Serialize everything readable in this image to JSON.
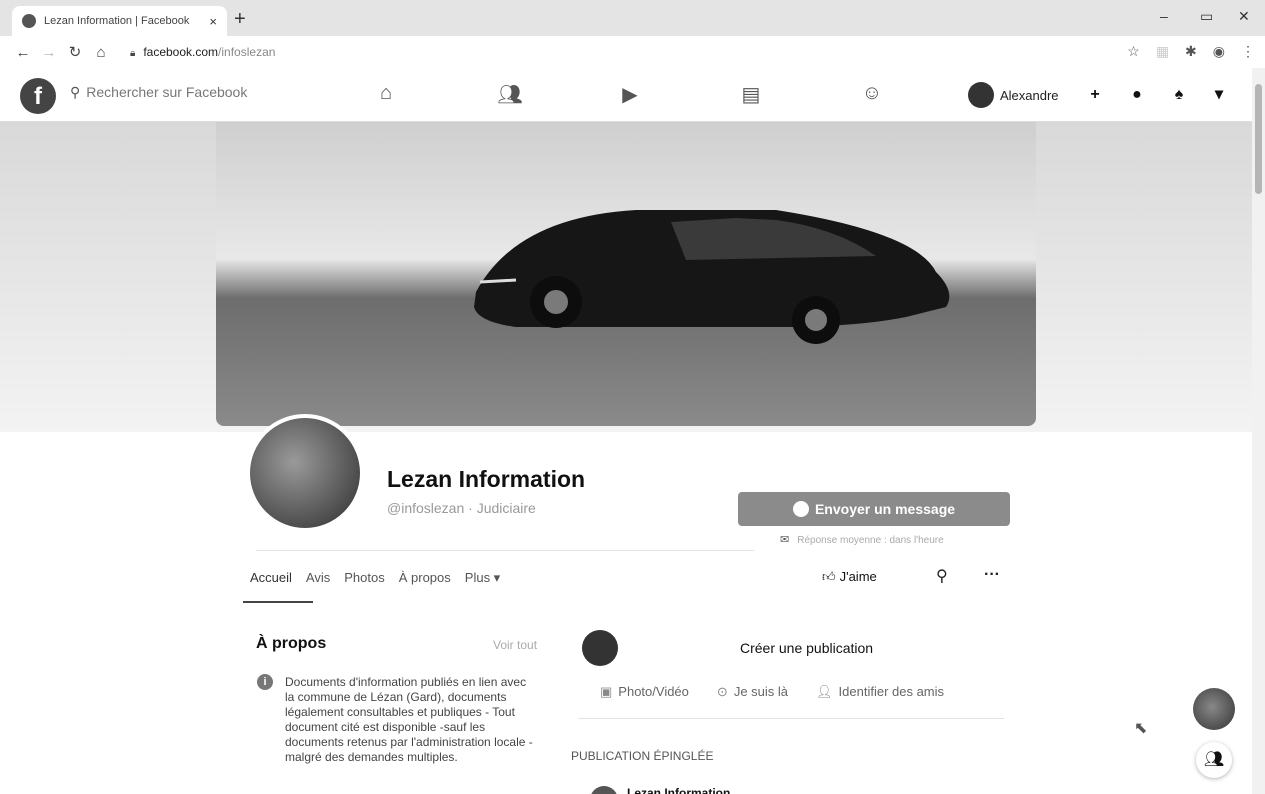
{
  "browser": {
    "tab_title": "Lezan Information | Facebook",
    "tab_close": "×",
    "new_tab": "+",
    "url_domain": "facebook.com",
    "url_path": "/infoslezan",
    "minimize": "–",
    "restore": "▭",
    "close": "✕"
  },
  "fbnav": {
    "logo": "f",
    "search_placeholder": "Rechercher sur Facebook",
    "user_name": "Alexandre",
    "create": "+"
  },
  "profile": {
    "name": "Lezan Information",
    "handle": "@infoslezan · Judiciaire",
    "message_button": "Envoyer un message",
    "response_time": "Réponse moyenne : dans l'heure"
  },
  "tabs": [
    "Accueil",
    "Avis",
    "Photos",
    "À propos",
    "Plus ▾"
  ],
  "actions": {
    "like": "J'aime"
  },
  "about": {
    "title": "À propos",
    "see_all": "Voir tout",
    "description": "Documents d'information publiés en lien avec la commune de Lézan (Gard), documents légalement consultables et publiques - Tout document cité est disponible -sauf les documents retenus par l'administration locale - malgré des demandes multiples."
  },
  "composer": {
    "title": "Créer une publication",
    "photo_video": "Photo/Vidéo",
    "checkin": "Je suis là",
    "tag_friends": "Identifier des amis"
  },
  "feed": {
    "pinned_label": "PUBLICATION ÉPINGLÉE",
    "pinned_author": "Lezan Information"
  }
}
